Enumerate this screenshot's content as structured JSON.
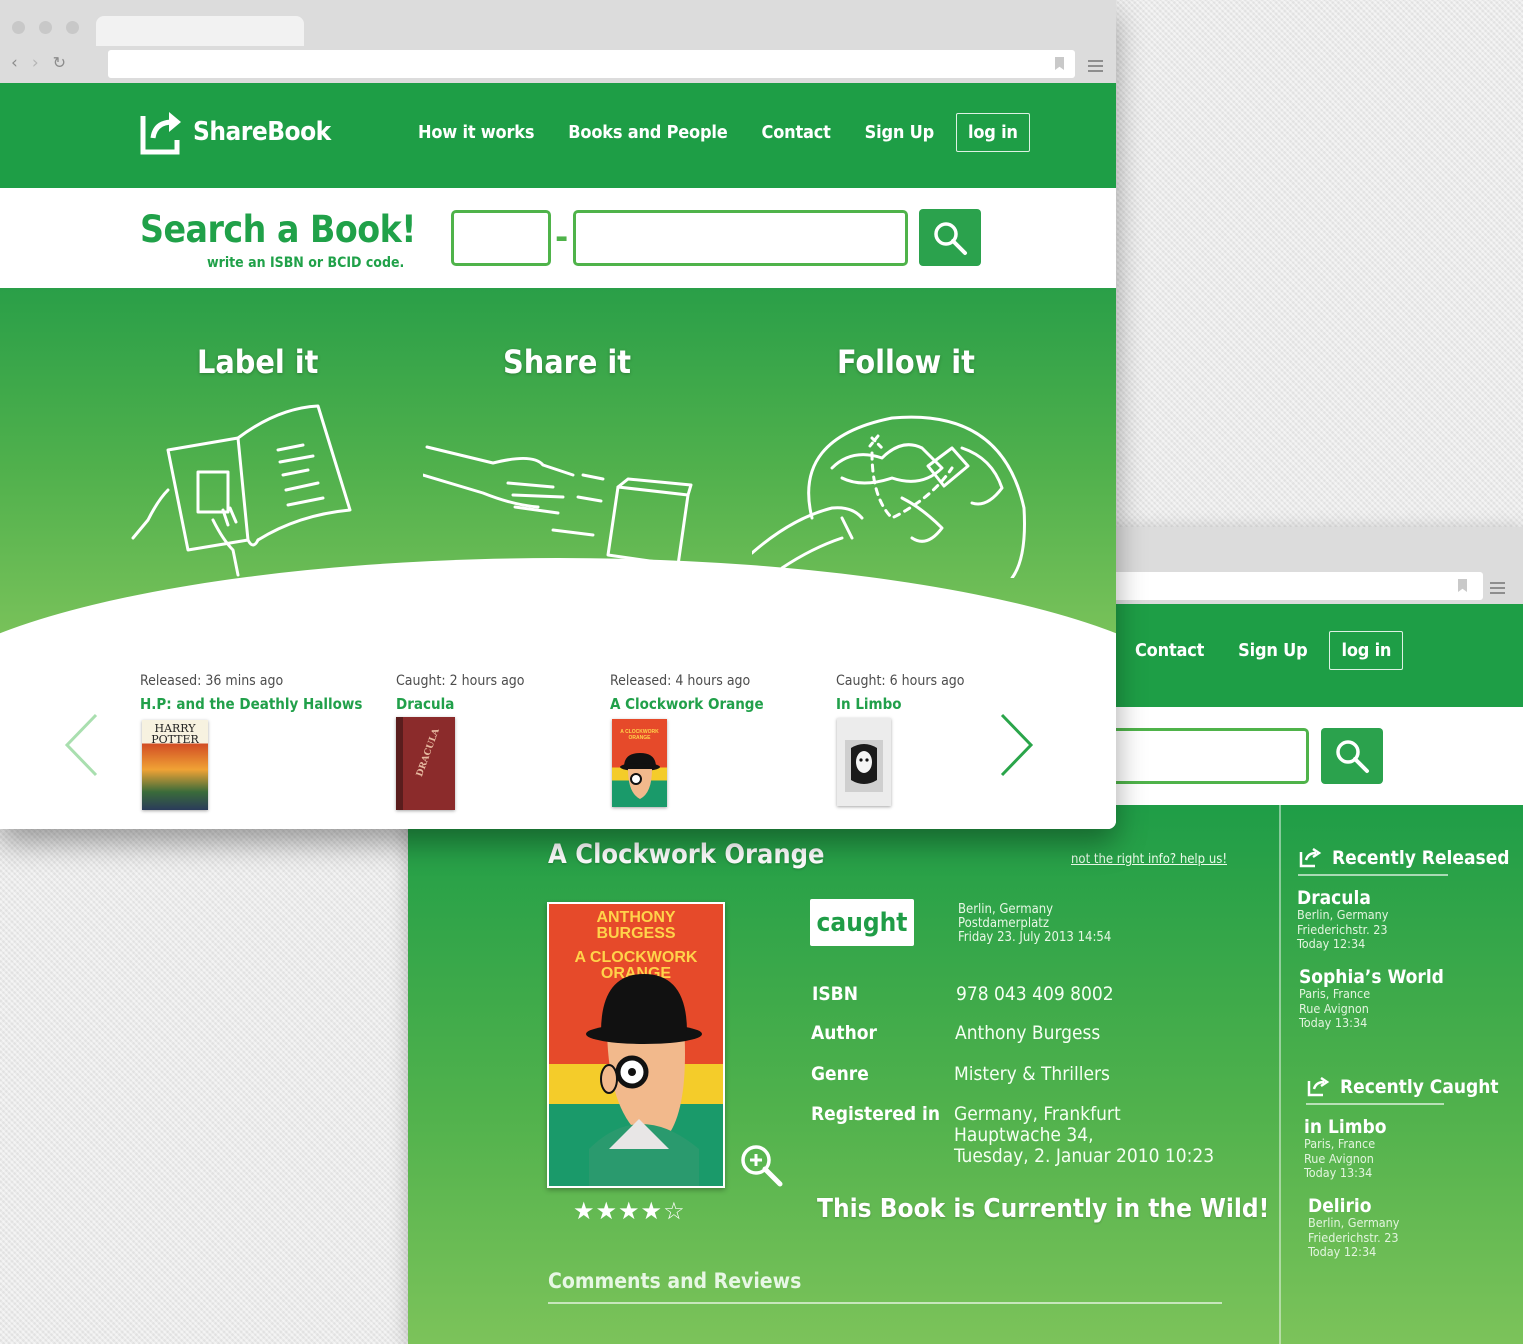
{
  "brand": {
    "name": "ShareBook"
  },
  "nav": {
    "how": "How it works",
    "books": "Books and People",
    "contact": "Contact",
    "signup": "Sign Up",
    "login": "log in"
  },
  "search": {
    "heading": "Search a Book!",
    "sub": "write an ISBN or BCID code.",
    "separator": "-"
  },
  "hero": {
    "steps": [
      {
        "title": "Label it"
      },
      {
        "title": "Share it"
      },
      {
        "title": "Follow it"
      }
    ],
    "active_slide": 2,
    "slide_count": 3
  },
  "recent": [
    {
      "status": "Released: 36 mins ago",
      "title": "H.P: and the Deathly Hallows",
      "cover_text": "HARRY POTTER"
    },
    {
      "status": "Caught: 2 hours ago",
      "title": "Dracula",
      "cover_text": "DRACULA"
    },
    {
      "status": "Released: 4 hours ago",
      "title": "A Clockwork Orange",
      "cover_text": "A CLOCKWORK ORANGE"
    },
    {
      "status": "Caught: 6 hours ago",
      "title": "In Limbo",
      "cover_text": ""
    }
  ],
  "book": {
    "title": "A Clockwork Orange",
    "help": "not the right info? help us!",
    "badge": "caught",
    "caught_location": [
      "Berlin, Germany",
      "Postdamerplatz",
      "Friday 23. July 2013 14:54"
    ],
    "cover_author": "ANTHONY BURGESS",
    "cover_title": "A CLOCKWORK ORANGE",
    "fields": [
      {
        "label": "ISBN",
        "value": "978 043 409 8002"
      },
      {
        "label": "Author",
        "value": "Anthony Burgess"
      },
      {
        "label": "Genre",
        "value": "Mistery & Thrillers"
      },
      {
        "label": "Registered in",
        "value_lines": [
          "Germany, Frankfurt",
          "Hauptwache 34,",
          "Tuesday, 2. Januar 2010 10:23"
        ]
      }
    ],
    "rating": {
      "stars": "★★★★☆",
      "value": 4,
      "max": 5
    },
    "wild": "This Book is Currently in the Wild!",
    "comments": "Comments and Reviews"
  },
  "sidebar": {
    "released_heading": "Recently Released",
    "released": [
      {
        "title": "Dracula",
        "lines": [
          "Berlin, Germany",
          "Friederichstr. 23",
          "Today 12:34"
        ]
      },
      {
        "title": "Sophia’s World",
        "lines": [
          "Paris, France",
          "Rue Avignon",
          "Today 13:34"
        ]
      }
    ],
    "caught_heading": "Recently Caught",
    "caught": [
      {
        "title": "in Limbo",
        "lines": [
          "Paris, France",
          "Rue Avignon",
          "Today 13:34"
        ]
      },
      {
        "title": "Delirio",
        "lines": [
          "Berlin, Germany",
          "Friederichstr. 23",
          "Today 12:34"
        ]
      }
    ]
  },
  "colors": {
    "brand_green": "#1e9e46",
    "accent_green": "#4fb34a",
    "light_green": "#7cc35a"
  }
}
